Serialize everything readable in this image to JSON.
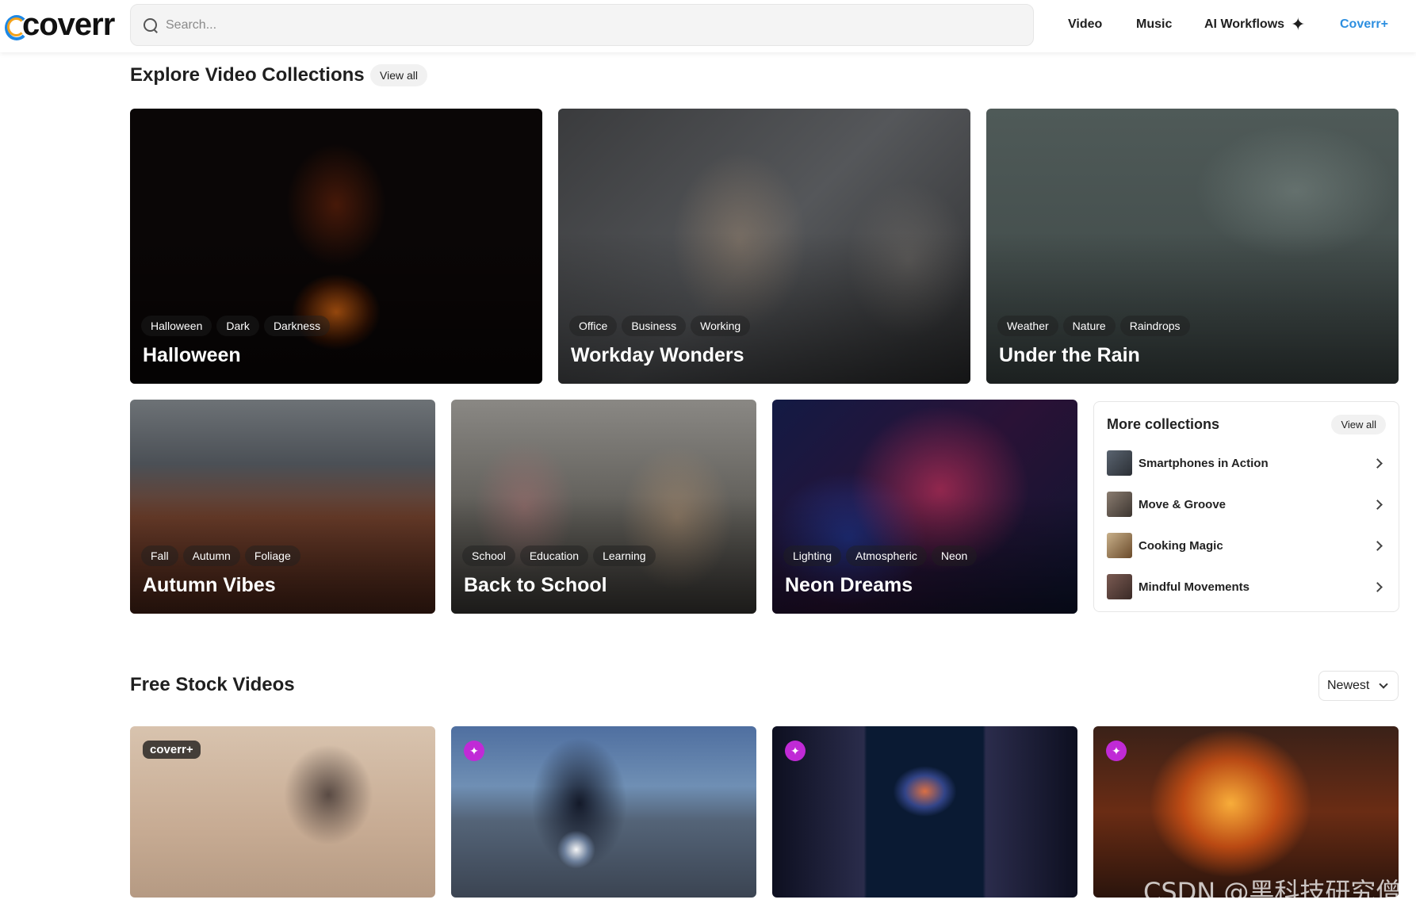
{
  "header": {
    "logo_text": "coverr",
    "search_placeholder": "Search...",
    "nav": {
      "video": "Video",
      "music": "Music",
      "ai_workflows": "AI Workflows",
      "coverr_plus": "Coverr+"
    }
  },
  "collections": {
    "title": "Explore Video Collections",
    "view_all": "View all",
    "cards": [
      {
        "title": "Halloween",
        "tags": [
          "Halloween",
          "Dark",
          "Darkness"
        ]
      },
      {
        "title": "Workday Wonders",
        "tags": [
          "Office",
          "Business",
          "Working"
        ]
      },
      {
        "title": "Under the Rain",
        "tags": [
          "Weather",
          "Nature",
          "Raindrops"
        ]
      },
      {
        "title": "Autumn Vibes",
        "tags": [
          "Fall",
          "Autumn",
          "Foliage"
        ]
      },
      {
        "title": "Back to School",
        "tags": [
          "School",
          "Education",
          "Learning"
        ]
      },
      {
        "title": "Neon Dreams",
        "tags": [
          "Lighting",
          "Atmospheric",
          "Neon"
        ]
      }
    ]
  },
  "more_collections": {
    "title": "More collections",
    "view_all": "View all",
    "items": [
      {
        "label": "Smartphones in Action"
      },
      {
        "label": "Move & Groove"
      },
      {
        "label": "Cooking Magic"
      },
      {
        "label": "Mindful Movements"
      }
    ]
  },
  "free_stock": {
    "title": "Free Stock Videos",
    "sort_value": "Newest",
    "videos": [
      {
        "badge": "coverr+"
      },
      {
        "badge": "ai"
      },
      {
        "badge": "ai"
      },
      {
        "badge": "ai"
      }
    ]
  },
  "watermark": "CSDN @黑科技研究僧",
  "colors": {
    "accent": "#2d8fe0",
    "ai_badge": "#c02ad6"
  }
}
